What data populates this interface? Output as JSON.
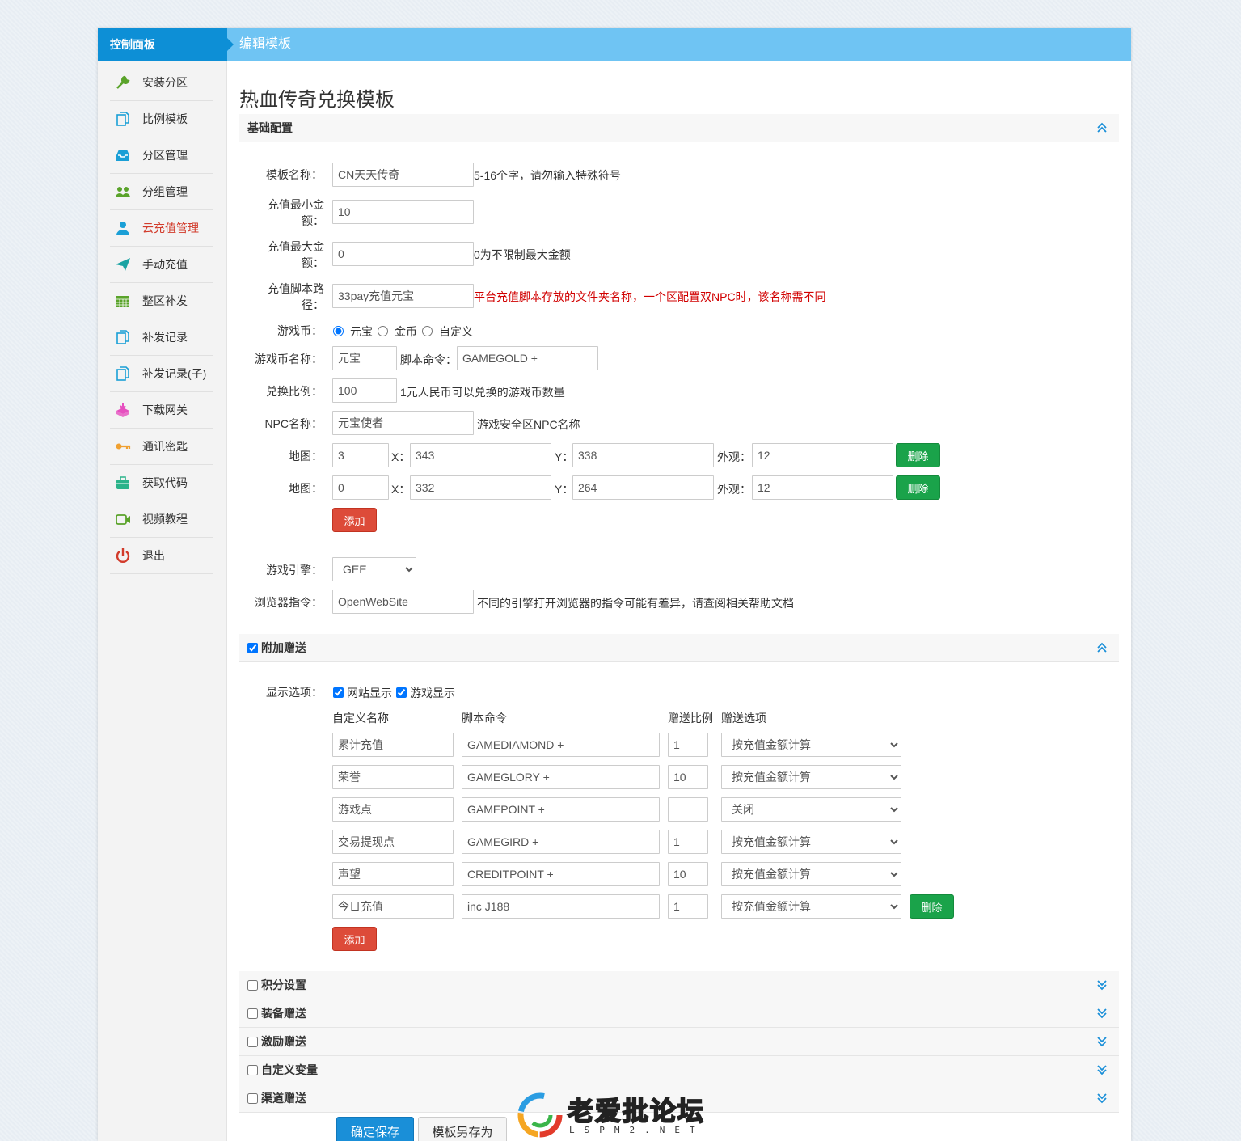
{
  "topbar": {
    "left_title": "控制面板",
    "right_title": "编辑模板"
  },
  "sidebar": {
    "items": [
      {
        "label": "安装分区",
        "icon": "wrench-icon",
        "color": "#5aa32a"
      },
      {
        "label": "比例模板",
        "icon": "copy-icon",
        "color": "#1a9fd6"
      },
      {
        "label": "分区管理",
        "icon": "inbox-icon",
        "color": "#1a9fd6"
      },
      {
        "label": "分组管理",
        "icon": "users-icon",
        "color": "#5aa32a"
      },
      {
        "label": "云充值管理",
        "icon": "user-icon",
        "color": "#1a9fd6",
        "active": true
      },
      {
        "label": "手动充值",
        "icon": "paper-plane-icon",
        "color": "#1aa3a3"
      },
      {
        "label": "整区补发",
        "icon": "calendar-icon",
        "color": "#5aa32a"
      },
      {
        "label": "补发记录",
        "icon": "copy-icon",
        "color": "#1a9fd6"
      },
      {
        "label": "补发记录(子)",
        "icon": "copy-icon",
        "color": "#1a9fd6"
      },
      {
        "label": "下载网关",
        "icon": "download-box-icon",
        "color": "#e64fbf"
      },
      {
        "label": "通讯密匙",
        "icon": "key-icon",
        "color": "#f0a030"
      },
      {
        "label": "获取代码",
        "icon": "briefcase-icon",
        "color": "#2bb38a"
      },
      {
        "label": "视频教程",
        "icon": "video-icon",
        "color": "#5aa32a"
      },
      {
        "label": "退出",
        "icon": "power-icon",
        "color": "#d23b2b"
      }
    ]
  },
  "page": {
    "title": "热血传奇兑换模板"
  },
  "basic": {
    "section_title": "基础配置",
    "template_name": {
      "label": "模板名称：",
      "value": "CN天天传奇",
      "hint": "5-16个字，请勿输入特殊符号"
    },
    "min_amount": {
      "label": "充值最小金额：",
      "value": "10"
    },
    "max_amount": {
      "label": "充值最大金额：",
      "value": "0",
      "hint": "0为不限制最大金额"
    },
    "script_path": {
      "label": "充值脚本路径：",
      "value": "33pay充值元宝",
      "hint": "平台充值脚本存放的文件夹名称，一个区配置双NPC时，该名称需不同"
    },
    "currency": {
      "label": "游戏币：",
      "options": [
        "元宝",
        "金币",
        "自定义"
      ],
      "selected": 0
    },
    "currency_name": {
      "label": "游戏币名称：",
      "value": "元宝"
    },
    "script_cmd": {
      "label": "脚本命令：",
      "value": "GAMEGOLD +"
    },
    "ratio": {
      "label": "兑换比例：",
      "value": "100",
      "hint": "1元人民币可以兑换的游戏币数量"
    },
    "npc": {
      "label": "NPC名称：",
      "value": "元宝使者",
      "hint": "游戏安全区NPC名称"
    },
    "maps": [
      {
        "label": "地图：",
        "map": "3",
        "x_label": "X：",
        "x": "343",
        "y_label": "Y：",
        "y": "338",
        "look_label": "外观：",
        "look": "12",
        "delete": "删除"
      },
      {
        "label": "地图：",
        "map": "0",
        "x_label": "X：",
        "x": "332",
        "y_label": "Y：",
        "y": "264",
        "look_label": "外观：",
        "look": "12",
        "delete": "删除"
      }
    ],
    "add_label": "添加",
    "engine": {
      "label": "游戏引擎：",
      "value": "GEE"
    },
    "browser_cmd": {
      "label": "浏览器指令：",
      "value": "OpenWebSite",
      "hint": "不同的引擎打开浏览器的指令可能有差异，请查阅相关帮助文档"
    }
  },
  "bonus": {
    "section_title": "附加赠送",
    "display": {
      "label": "显示选项：",
      "website": "网站显示",
      "game": "游戏显示"
    },
    "headers": {
      "name": "自定义名称",
      "cmd": "脚本命令",
      "ratio": "赠送比例",
      "option": "赠送选项"
    },
    "rows": [
      {
        "name": "累计充值",
        "cmd": "GAMEDIAMOND +",
        "ratio": "1",
        "option": "按充值金额计算"
      },
      {
        "name": "荣誉",
        "cmd": "GAMEGLORY +",
        "ratio": "10",
        "option": "按充值金额计算"
      },
      {
        "name": "游戏点",
        "cmd": "GAMEPOINT +",
        "ratio": "",
        "option": "关闭"
      },
      {
        "name": "交易提现点",
        "cmd": "GAMEGIRD +",
        "ratio": "1",
        "option": "按充值金额计算"
      },
      {
        "name": "声望",
        "cmd": "CREDITPOINT +",
        "ratio": "10",
        "option": "按充值金额计算"
      },
      {
        "name": "今日充值",
        "cmd": "inc J188",
        "ratio": "1",
        "option": "按充值金额计算",
        "delete": "删除"
      }
    ],
    "add_label": "添加"
  },
  "collapsed_sections": [
    "积分设置",
    "装备赠送",
    "激励赠送",
    "自定义变量",
    "渠道赠送"
  ],
  "footer": {
    "save": "确定保存",
    "save_as": "模板另存为"
  },
  "watermark": {
    "text": "老爱批论坛",
    "sub": "LSPM2.NET"
  }
}
